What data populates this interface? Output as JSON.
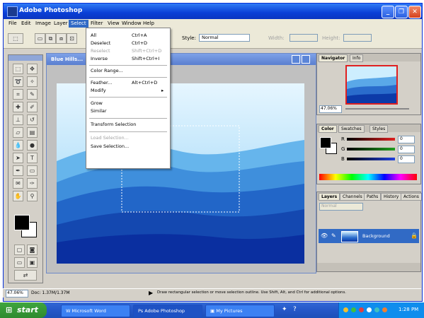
{
  "window": {
    "title": "Adobe Photoshop"
  },
  "menubar": [
    {
      "label": "File"
    },
    {
      "label": "Edit"
    },
    {
      "label": "Image"
    },
    {
      "label": "Layer"
    },
    {
      "label": "Select"
    },
    {
      "label": "Filter"
    },
    {
      "label": "View"
    },
    {
      "label": "Window"
    },
    {
      "label": "Help"
    }
  ],
  "options": {
    "style_label": "Style:",
    "style_value": "Normal",
    "width_label": "Width:",
    "height_label": "Height:"
  },
  "document": {
    "title": "Blue Hills..."
  },
  "select_menu": [
    {
      "label": "All",
      "shortcut": "Ctrl+A",
      "enabled": true
    },
    {
      "label": "Deselect",
      "shortcut": "Ctrl+D",
      "enabled": true
    },
    {
      "label": "Reselect",
      "shortcut": "Shift+Ctrl+D",
      "enabled": false
    },
    {
      "label": "Inverse",
      "shortcut": "Shift+Ctrl+I",
      "enabled": true
    },
    {
      "label": "Color Range...",
      "shortcut": "",
      "enabled": true
    },
    {
      "label": "Feather...",
      "shortcut": "Alt+Ctrl+D",
      "enabled": true
    },
    {
      "label": "Modify",
      "shortcut": "▸",
      "enabled": true
    },
    {
      "label": "Grow",
      "shortcut": "",
      "enabled": true
    },
    {
      "label": "Similar",
      "shortcut": "",
      "enabled": true
    },
    {
      "label": "Transform Selection",
      "shortcut": "",
      "enabled": true
    },
    {
      "label": "Load Selection...",
      "shortcut": "",
      "enabled": false
    },
    {
      "label": "Save Selection...",
      "shortcut": "",
      "enabled": true
    }
  ],
  "navigator": {
    "tabs": [
      "Navigator",
      "Info"
    ],
    "zoom": "47.06%"
  },
  "color_panel": {
    "tabs": [
      "Color",
      "Swatches",
      "Styles"
    ],
    "channels": [
      {
        "name": "R",
        "value": "0",
        "color": "#e02020"
      },
      {
        "name": "G",
        "value": "0",
        "color": "#20a020"
      },
      {
        "name": "B",
        "value": "0",
        "color": "#2040e0"
      }
    ]
  },
  "layers_panel": {
    "tabs": [
      "Layers",
      "Channels",
      "Paths",
      "History",
      "Actions"
    ],
    "blend_mode": "Normal",
    "layer_name": "Background"
  },
  "statusbar": {
    "zoom": "47.06%",
    "doc_size": "Doc: 1.37M/1.37M",
    "hint": "Draw rectangular selection or move selection outline. Use Shift, Alt, and Ctrl for additional options."
  },
  "taskbar": {
    "start_label": "start",
    "tasks": [
      {
        "label": "Microsoft Word"
      },
      {
        "label": "Adobe Photoshop"
      },
      {
        "label": "My Pictures"
      }
    ],
    "time": "1:28 PM"
  },
  "colors": {
    "accent": "#316ac5",
    "titlebar": "#0a3fd6",
    "sky": "#dff3ff",
    "hills_dark": "#0a2fa0"
  }
}
